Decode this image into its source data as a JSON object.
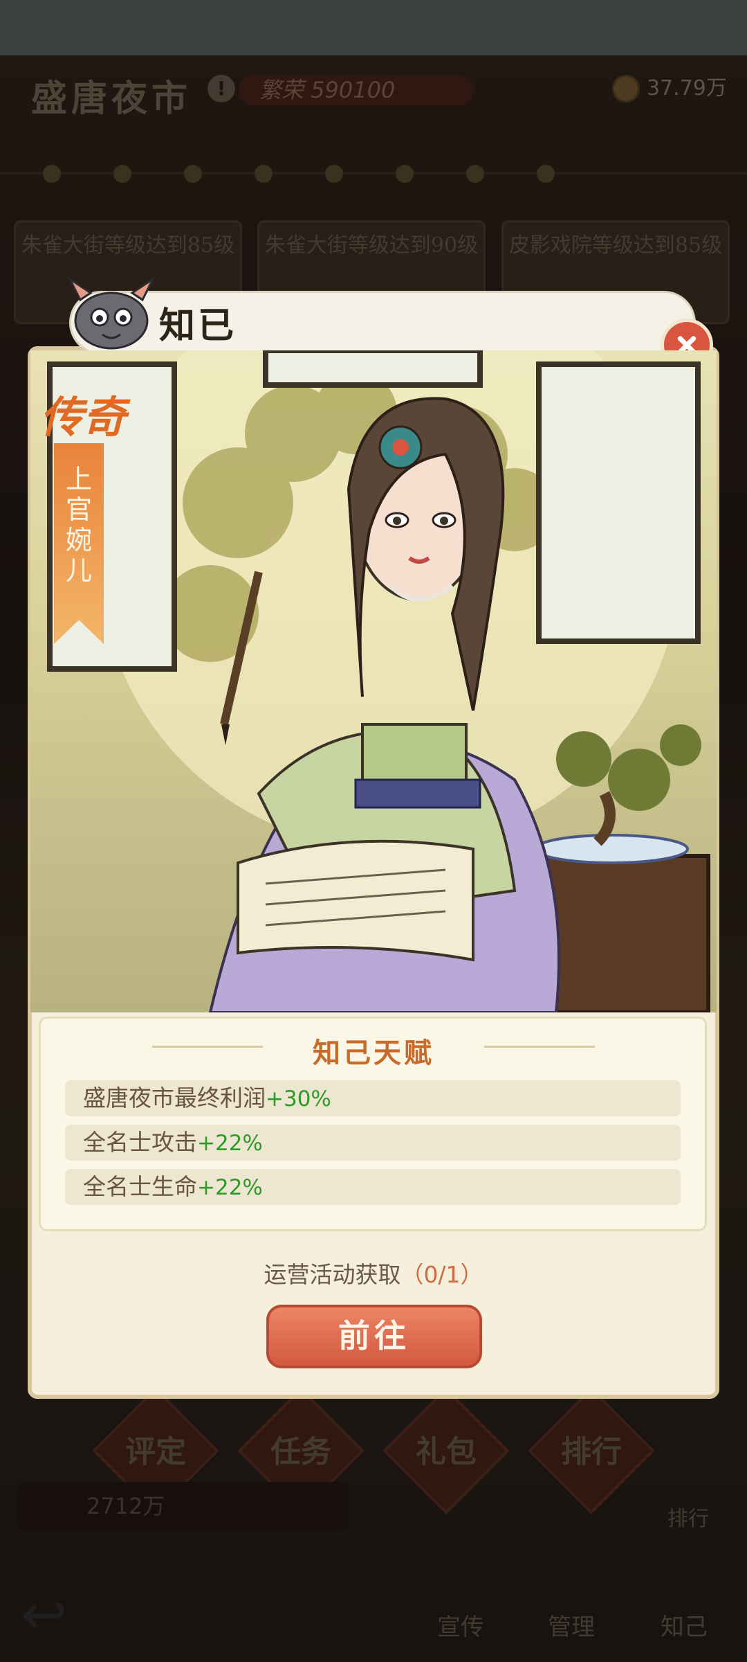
{
  "game": {
    "title": "盛唐夜市",
    "prosperity": "繁荣 590100",
    "coins": "37.79万",
    "gold": "2712万"
  },
  "tasks": [
    {
      "text": "朱雀大街等级达到85级"
    },
    {
      "text": "朱雀大街等级达到90级"
    },
    {
      "text": "皮影戏院等级达到85级"
    }
  ],
  "bottom_buttons": [
    {
      "label": "评定"
    },
    {
      "label": "任务"
    },
    {
      "label": "礼包"
    },
    {
      "label": "排行"
    }
  ],
  "nav": [
    {
      "label": "宣传"
    },
    {
      "label": "管理"
    },
    {
      "label": "知己"
    }
  ],
  "side_label": "排行",
  "popup": {
    "title": "知已",
    "rarity": "传奇",
    "character_name": "上官婉儿",
    "talent_title": "知己天赋",
    "talents": [
      {
        "label": "盛唐夜市最终利润",
        "value": "+30%"
      },
      {
        "label": "全名士攻击",
        "value": "+22%"
      },
      {
        "label": "全名士生命",
        "value": "+22%"
      }
    ],
    "acquire_text": "运营活动获取",
    "acquire_count": "（0/1）",
    "go_button": "前往"
  },
  "colors": {
    "accent_red": "#d9553f",
    "talent_green": "#2f9a2a",
    "rarity_orange": "#e06a24"
  }
}
